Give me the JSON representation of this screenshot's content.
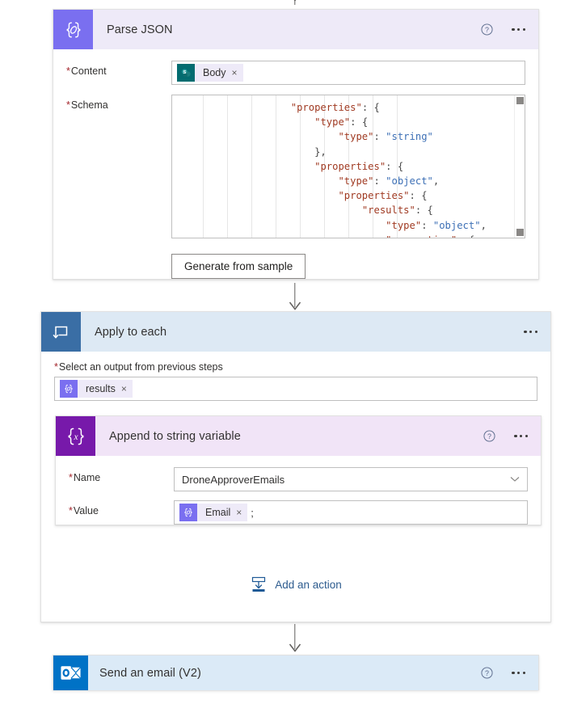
{
  "flow": {
    "nodes": [
      {
        "id": "parse-json",
        "title": "Parse JSON",
        "icon": "parse-json-icon",
        "icon_bg": "#7a6ff0",
        "header_bg": "#eeeaf8",
        "help_label": "?",
        "more_label": "More commands"
      },
      {
        "id": "apply-to-each",
        "title": "Apply to each",
        "icon": "loop-icon",
        "icon_bg": "#3a6ea5",
        "header_bg": "#dde9f4",
        "more_label": "More commands"
      },
      {
        "id": "append-to-string-variable",
        "title": "Append to string variable",
        "icon": "variables-icon",
        "icon_bg": "#7719aa",
        "header_bg": "#f1e4f7",
        "help_label": "?",
        "more_label": "More commands"
      },
      {
        "id": "send-an-email-v2",
        "title": "Send an email (V2)",
        "icon": "outlook-icon",
        "icon_bg": "#0072c6",
        "header_bg": "#dbeaf7",
        "help_label": "?",
        "more_label": "More commands"
      }
    ]
  },
  "parse_json": {
    "content": {
      "label": "Content",
      "required": true,
      "token": {
        "label": "Body",
        "icon": "sharepoint-icon",
        "remove_label": "×"
      }
    },
    "schema": {
      "label": "Schema",
      "required": true,
      "lines": [
        [
          {
            "t": "                    ",
            "c": "p"
          },
          {
            "t": "\"properties\"",
            "c": "k"
          },
          {
            "t": ": {",
            "c": "p"
          }
        ],
        [
          {
            "t": "                        ",
            "c": "p"
          },
          {
            "t": "\"type\"",
            "c": "k"
          },
          {
            "t": ": {",
            "c": "p"
          }
        ],
        [
          {
            "t": "                            ",
            "c": "p"
          },
          {
            "t": "\"type\"",
            "c": "k"
          },
          {
            "t": ": ",
            "c": "p"
          },
          {
            "t": "\"string\"",
            "c": "s"
          }
        ],
        [
          {
            "t": "                        },",
            "c": "p"
          }
        ],
        [
          {
            "t": "                        ",
            "c": "p"
          },
          {
            "t": "\"properties\"",
            "c": "k"
          },
          {
            "t": ": {",
            "c": "p"
          }
        ],
        [
          {
            "t": "                            ",
            "c": "p"
          },
          {
            "t": "\"type\"",
            "c": "k"
          },
          {
            "t": ": ",
            "c": "p"
          },
          {
            "t": "\"object\"",
            "c": "s"
          },
          {
            "t": ",",
            "c": "p"
          }
        ],
        [
          {
            "t": "                            ",
            "c": "p"
          },
          {
            "t": "\"properties\"",
            "c": "k"
          },
          {
            "t": ": {",
            "c": "p"
          }
        ],
        [
          {
            "t": "                                ",
            "c": "p"
          },
          {
            "t": "\"results\"",
            "c": "k"
          },
          {
            "t": ": {",
            "c": "p"
          }
        ],
        [
          {
            "t": "                                    ",
            "c": "p"
          },
          {
            "t": "\"type\"",
            "c": "k"
          },
          {
            "t": ": ",
            "c": "p"
          },
          {
            "t": "\"object\"",
            "c": "s"
          },
          {
            "t": ",",
            "c": "p"
          }
        ],
        [
          {
            "t": "                                    ",
            "c": "p"
          },
          {
            "t": "\"properties\"",
            "c": "k"
          },
          {
            "t": ": {",
            "c": "p"
          }
        ]
      ],
      "scrollbar": {
        "up_label": "Scroll up",
        "down_label": "Scroll down"
      }
    },
    "generate_button": "Generate from sample"
  },
  "apply_to_each": {
    "select_output": {
      "label": "Select an output from previous steps",
      "required": true,
      "token": {
        "label": "results",
        "icon": "parse-json-icon",
        "remove_label": "×"
      }
    },
    "add_action": {
      "label": "Add an action",
      "icon": "add-action-icon"
    }
  },
  "append_variable": {
    "name": {
      "label": "Name",
      "required": true,
      "value": "DroneApproverEmails",
      "icon": "chevron-down-icon"
    },
    "value": {
      "label": "Value",
      "required": true,
      "token": {
        "label": "Email",
        "icon": "parse-json-icon",
        "remove_label": "×"
      },
      "trailing_text": ";"
    }
  },
  "colors": {
    "parse_json_purple": "#7a6ff0",
    "variables_purple": "#7719aa",
    "loop_blue": "#3a6ea5",
    "outlook_blue": "#0072c6",
    "sharepoint_teal": "#036c70",
    "required_red": "#a4262c",
    "json_key": "#a03a22",
    "json_string": "#3c6fb5",
    "link_blue": "#2d5b8e"
  }
}
